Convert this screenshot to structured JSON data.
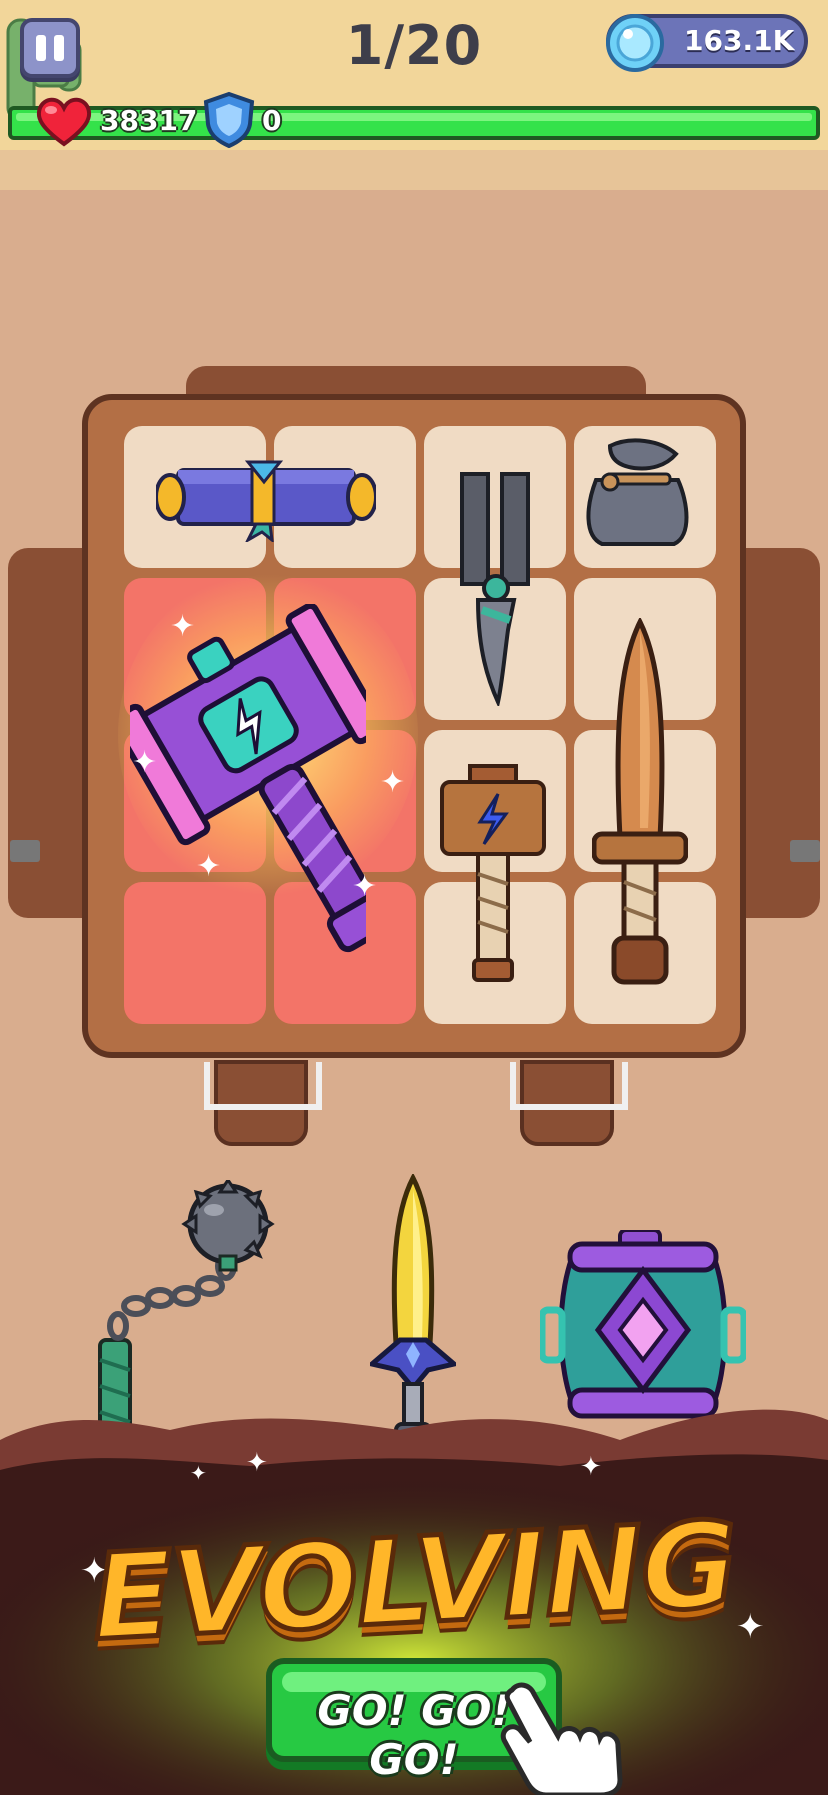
{
  "hud": {
    "pause_icon": "pause-icon",
    "wave_counter": "1/20",
    "gems": {
      "icon": "blue-gem-icon",
      "value": "163.1K"
    },
    "health": {
      "icon": "heart-icon",
      "value": "38317",
      "bar_fill": 1.0
    },
    "shield": {
      "icon": "shield-icon",
      "value": "0"
    }
  },
  "backpack": {
    "items": [
      {
        "name": "purple-scroll",
        "icon": "scroll-icon"
      },
      {
        "name": "iron-tongs",
        "icon": "tongs-icon"
      },
      {
        "name": "grey-sack",
        "icon": "sack-icon"
      },
      {
        "name": "lightning-hammer-evolved",
        "icon": "purple-hammer-icon",
        "highlight": true
      },
      {
        "name": "wooden-hammer",
        "icon": "wooden-hammer-icon"
      },
      {
        "name": "wooden-sword",
        "icon": "wooden-sword-icon"
      }
    ]
  },
  "shelf_items": [
    {
      "name": "flail",
      "icon": "flail-icon"
    },
    {
      "name": "golden-sword",
      "icon": "golden-sword-icon"
    },
    {
      "name": "purple-barrel",
      "icon": "barrel-icon"
    }
  ],
  "banner": {
    "title": "EVOLVING"
  },
  "cta": {
    "label": "GO! GO! GO!",
    "icon": "pointing-hand-icon"
  },
  "colors": {
    "health_bar": "#34e24a",
    "cta_button": "#27c943",
    "title": "#ffb629",
    "highlight_cell": "#f37468"
  }
}
